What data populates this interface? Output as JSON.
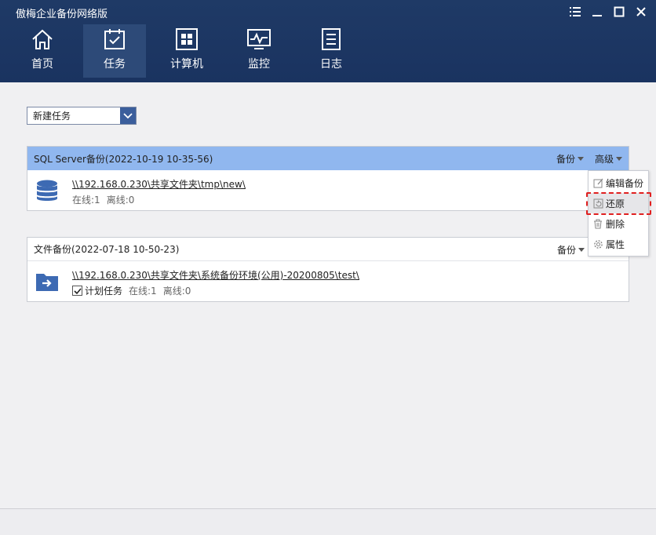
{
  "app": {
    "title": "傲梅企业备份网络版"
  },
  "nav": [
    {
      "label": "首页",
      "icon": "home-icon"
    },
    {
      "label": "任务",
      "icon": "task-calendar-icon",
      "active": true
    },
    {
      "label": "计算机",
      "icon": "windows-icon"
    },
    {
      "label": "监控",
      "icon": "monitor-icon"
    },
    {
      "label": "日志",
      "icon": "log-icon"
    }
  ],
  "toolbar": {
    "new_task": "新建任务"
  },
  "tasks": [
    {
      "title": "SQL Server备份(2022-10-19 10-35-56)",
      "backup_label": "备份",
      "advanced_label": "高级",
      "path": "\\\\192.168.0.230\\共享文件夹\\tmp\\new\\",
      "online": "在线:1",
      "offline": "离线:0",
      "icon": "database-icon"
    },
    {
      "title": "文件备份(2022-07-18 10-50-23)",
      "backup_label": "备份",
      "path": "\\\\192.168.0.230\\共享文件夹\\系统备份环境(公用)-20200805\\test\\",
      "scheduled": "计划任务",
      "online": "在线:1",
      "offline": "离线:0",
      "icon": "folder-arrow-icon"
    }
  ],
  "menu": [
    {
      "label": "编辑备份",
      "icon": "edit-icon"
    },
    {
      "label": "还原",
      "icon": "restore-icon",
      "highlighted": true
    },
    {
      "label": "删除",
      "icon": "trash-icon"
    },
    {
      "label": "属性",
      "icon": "gear-icon"
    }
  ],
  "colors": {
    "titlebar": "#1a3360",
    "selected_header": "#90b7ef",
    "accent": "#3b5e9c",
    "highlight_border": "#e02020"
  }
}
